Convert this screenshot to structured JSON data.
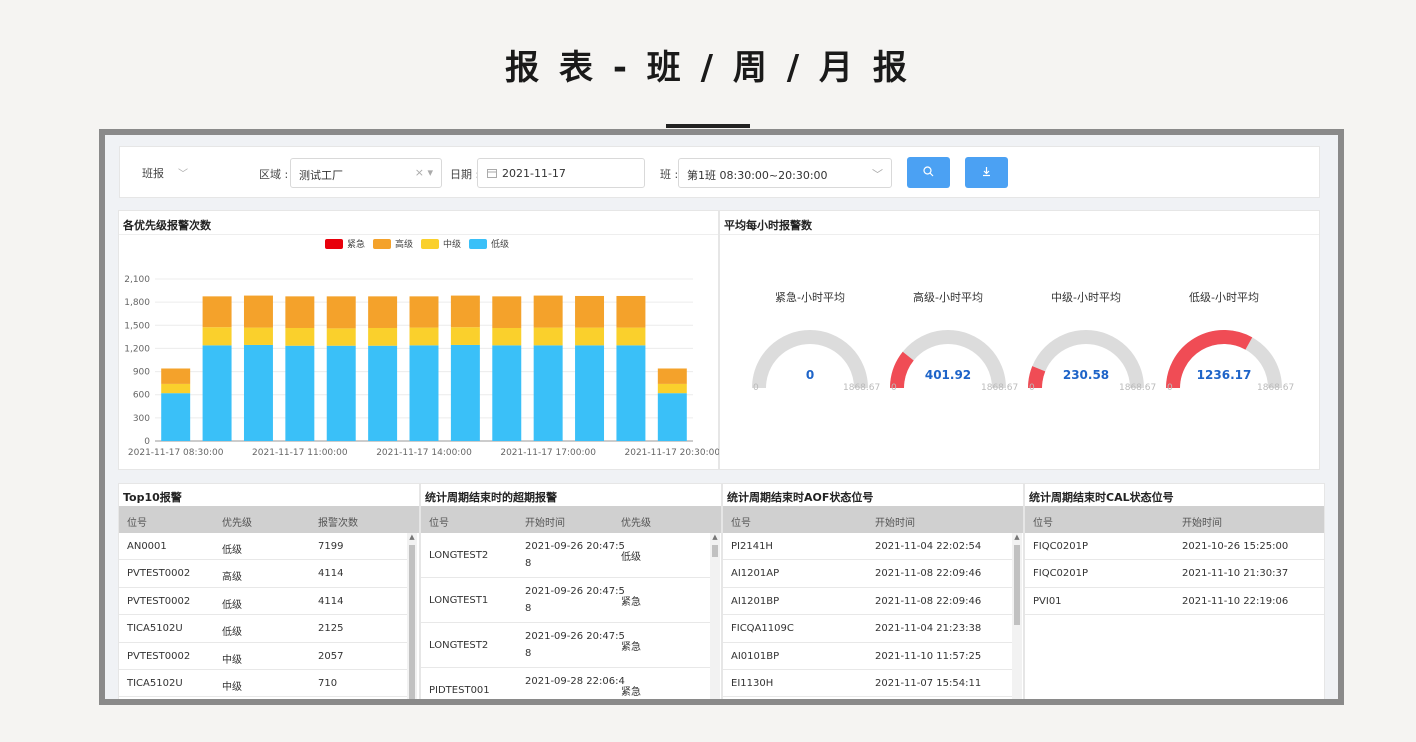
{
  "page_title": "报 表 - 班 / 周 / 月 报",
  "filters": {
    "report_type": "班报",
    "area_label": "区域 :",
    "area_value": "测试工厂",
    "date_label": "日期 :",
    "date_value": "2021-11-17",
    "shift_label": "班 :",
    "shift_value": "第1班 08:30:00~20:30:00",
    "clear_icon": "×",
    "search_icon": "search-icon",
    "download_icon": "download-icon"
  },
  "colors": {
    "urgent": "#e8000b",
    "high": "#f4a22b",
    "mid": "#fad02c",
    "low": "#3ac0f8",
    "accent": "#4ba1f3",
    "gauge_fill": "#f04c55",
    "gauge_track": "#dcdcdc"
  },
  "bar_panel": {
    "title": "各优先级报警次数",
    "legend": [
      "紧急",
      "高级",
      "中级",
      "低级"
    ]
  },
  "chart_data": {
    "type": "bar",
    "stacked": true,
    "categories": [
      "2021-11-17 08:30:00",
      "",
      "",
      "2021-11-17 11:00:00",
      "",
      "",
      "2021-11-17 14:00:00",
      "",
      "",
      "2021-11-17 17:00:00",
      "",
      "",
      "2021-11-17 20:30:00"
    ],
    "x_tick_labels": [
      "2021-11-17 08:30:00",
      "2021-11-17 11:00:00",
      "2021-11-17 14:00:00",
      "2021-11-17 17:00:00",
      "2021-11-17 20:30:00"
    ],
    "series": [
      {
        "name": "紧急",
        "values": [
          0,
          0,
          0,
          0,
          0,
          0,
          0,
          0,
          0,
          0,
          0,
          0,
          0
        ]
      },
      {
        "name": "低级",
        "values": [
          620,
          1240,
          1245,
          1235,
          1235,
          1235,
          1240,
          1245,
          1240,
          1240,
          1240,
          1240,
          620
        ]
      },
      {
        "name": "中级",
        "values": [
          120,
          235,
          225,
          230,
          225,
          230,
          230,
          230,
          225,
          230,
          230,
          230,
          120
        ]
      },
      {
        "name": "高级",
        "values": [
          200,
          400,
          415,
          410,
          415,
          410,
          405,
          410,
          410,
          415,
          410,
          410,
          200
        ]
      }
    ],
    "y_ticks": [
      "0",
      "300",
      "600",
      "900",
      "1,200",
      "1,500",
      "1,800",
      "2,100"
    ],
    "ylim": [
      0,
      2100
    ],
    "grid": true,
    "legend_position": "top-center"
  },
  "gauge_panel": {
    "title": "平均每小时报警数",
    "gauges": [
      {
        "title": "紧急-小时平均",
        "value": "0",
        "min": "0",
        "max": "1868.67",
        "fraction": 0.0
      },
      {
        "title": "高级-小时平均",
        "value": "401.92",
        "min": "0",
        "max": "1868.67",
        "fraction": 0.215
      },
      {
        "title": "中级-小时平均",
        "value": "230.58",
        "min": "0",
        "max": "1868.67",
        "fraction": 0.123
      },
      {
        "title": "低级-小时平均",
        "value": "1236.17",
        "min": "0",
        "max": "1868.67",
        "fraction": 0.662
      }
    ]
  },
  "tables": {
    "top10": {
      "title": "Top10报警",
      "headers": [
        "位号",
        "优先级",
        "报警次数"
      ],
      "rows": [
        [
          "AN0001",
          "低级",
          "7199"
        ],
        [
          "PVTEST0002",
          "高级",
          "4114"
        ],
        [
          "PVTEST0002",
          "低级",
          "4114"
        ],
        [
          "TICA5102U",
          "低级",
          "2125"
        ],
        [
          "PVTEST0002",
          "中级",
          "2057"
        ],
        [
          "TICA5102U",
          "中级",
          "710"
        ]
      ]
    },
    "overdue": {
      "title": "统计周期结束时的超期报警",
      "headers": [
        "位号",
        "开始时间",
        "优先级"
      ],
      "rows": [
        [
          "LONGTEST2",
          "2021-09-26 20:47:5",
          "8",
          "低级"
        ],
        [
          "LONGTEST1",
          "2021-09-26 20:47:5",
          "8",
          "紧急"
        ],
        [
          "LONGTEST2",
          "2021-09-26 20:47:5",
          "8",
          "紧急"
        ],
        [
          "PIDTEST001",
          "2021-09-28 22:06:4",
          "",
          "紧急"
        ]
      ]
    },
    "aof": {
      "title": "统计周期结束时AOF状态位号",
      "headers": [
        "位号",
        "开始时间"
      ],
      "rows": [
        [
          "PI2141H",
          "2021-11-04 22:02:54"
        ],
        [
          "AI1201AP",
          "2021-11-08 22:09:46"
        ],
        [
          "AI1201BP",
          "2021-11-08 22:09:46"
        ],
        [
          "FICQA1109C",
          "2021-11-04 21:23:38"
        ],
        [
          "AI0101BP",
          "2021-11-10 11:57:25"
        ],
        [
          "EI1130H",
          "2021-11-07 15:54:11"
        ]
      ]
    },
    "cal": {
      "title": "统计周期结束时CAL状态位号",
      "headers": [
        "位号",
        "开始时间"
      ],
      "rows": [
        [
          "FIQC0201P",
          "2021-10-26 15:25:00"
        ],
        [
          "FIQC0201P",
          "2021-11-10 21:30:37"
        ],
        [
          "PVI01",
          "2021-11-10 22:19:06"
        ]
      ]
    }
  }
}
